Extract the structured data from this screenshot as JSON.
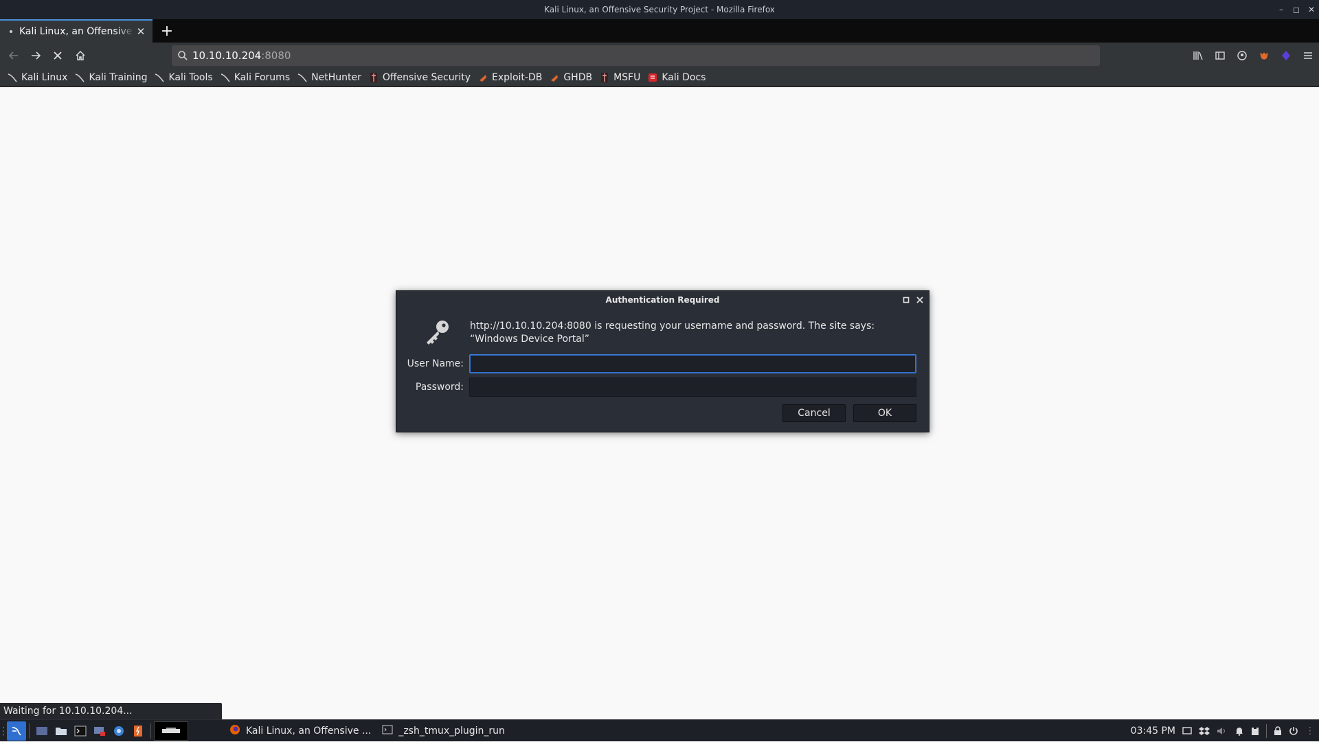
{
  "window": {
    "title": "Kali Linux, an Offensive Security Project - Mozilla Firefox",
    "minimize": "–",
    "maximize": "◻",
    "close": "✕"
  },
  "tab": {
    "title": "Kali Linux, an Offensive Security Project",
    "close": "✕",
    "new_tab": "+"
  },
  "nav": {
    "url_host": "10.10.10.204",
    "url_port": ":8080",
    "icons": [
      "back-icon",
      "forward-icon",
      "stop-icon",
      "home-icon",
      "search-icon",
      "library-icon",
      "sidebar-icon",
      "account-icon",
      "foxyproxy-icon",
      "extension-icon",
      "menu-icon"
    ]
  },
  "bookmarks": [
    {
      "label": "Kali Linux",
      "icon": "kali-dragon-icon"
    },
    {
      "label": "Kali Training",
      "icon": "kali-dragon-icon"
    },
    {
      "label": "Kali Tools",
      "icon": "kali-dragon-icon"
    },
    {
      "label": "Kali Forums",
      "icon": "kali-dragon-icon"
    },
    {
      "label": "NetHunter",
      "icon": "kali-dragon-icon"
    },
    {
      "label": "Offensive Security",
      "icon": "offsec-icon"
    },
    {
      "label": "Exploit-DB",
      "icon": "exploitdb-icon"
    },
    {
      "label": "GHDB",
      "icon": "exploitdb-icon"
    },
    {
      "label": "MSFU",
      "icon": "offsec-icon"
    },
    {
      "label": "Kali Docs",
      "icon": "kali-docs-icon"
    }
  ],
  "dialog": {
    "title": "Authentication Required",
    "message": "http://10.10.10.204:8080 is requesting your username and password. The site says: “Windows Device Portal”",
    "username_label": "User Name:",
    "username_value": "",
    "password_label": "Password:",
    "password_value": "",
    "cancel_label": "Cancel",
    "ok_label": "OK"
  },
  "status": {
    "text": "Waiting for 10.10.10.204..."
  },
  "taskbar": {
    "tasks": [
      {
        "label": "Kali Linux, an Offensive ...",
        "icon": "firefox-icon"
      },
      {
        "label": "_zsh_tmux_plugin_run",
        "icon": "terminal-icon"
      }
    ],
    "clock": "03:45 PM"
  },
  "colors": {
    "accent": "#3d7cd9",
    "dialog_bg": "#2a2e36",
    "toolbar_bg": "#323639"
  }
}
